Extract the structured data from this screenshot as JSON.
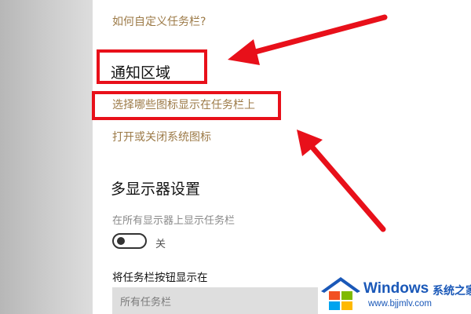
{
  "taskbar_settings": {
    "customize_link": "如何自定义任务栏?",
    "notification_area": {
      "heading": "通知区域",
      "select_icons_link": "选择哪些图标显示在任务栏上",
      "system_icons_link": "打开或关闭系统图标"
    },
    "multi_display": {
      "heading": "多显示器设置",
      "show_all_label": "在所有显示器上显示任务栏",
      "toggle_state": "关",
      "buttons_label": "将任务栏按钮显示在",
      "buttons_dropdown_value": "所有任务栏"
    }
  },
  "watermark": {
    "brand": "Windows",
    "cn": "系统之家",
    "url": "www.bjjmlv.com"
  },
  "colors": {
    "link": "#9c7a47",
    "highlight": "#e8101a",
    "watermark": "#1a58b8"
  }
}
